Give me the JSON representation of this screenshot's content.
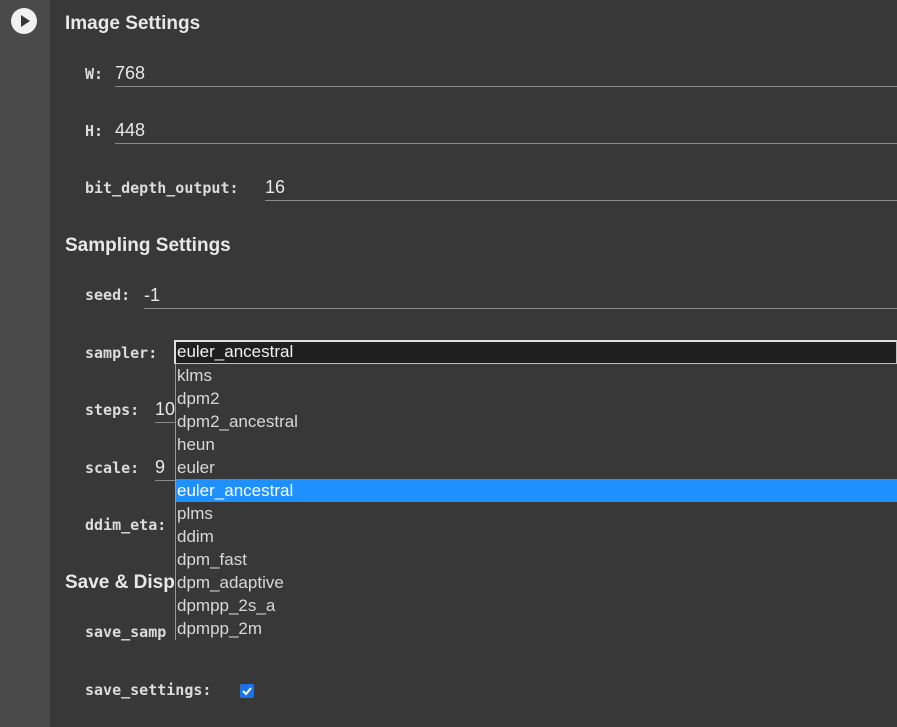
{
  "run_button": {
    "icon": "play-icon"
  },
  "image_settings": {
    "title": "Image Settings",
    "w": {
      "label": "W:",
      "value": "768"
    },
    "h": {
      "label": "H:",
      "value": "448"
    },
    "bit_depth_output": {
      "label": "bit_depth_output:",
      "value": "16"
    }
  },
  "sampling_settings": {
    "title": "Sampling Settings",
    "seed": {
      "label": "seed:",
      "value": "-1"
    },
    "sampler": {
      "label": "sampler:",
      "selected": "euler_ancestral",
      "options": [
        "klms",
        "dpm2",
        "dpm2_ancestral",
        "heun",
        "euler",
        "euler_ancestral",
        "plms",
        "ddim",
        "dpm_fast",
        "dpm_adaptive",
        "dpmpp_2s_a",
        "dpmpp_2m"
      ],
      "highlighted_index": 5
    },
    "steps": {
      "label": "steps:",
      "value": "10"
    },
    "scale": {
      "label": "scale:",
      "value": "9"
    },
    "ddim_eta": {
      "label": "ddim_eta:"
    }
  },
  "save_display": {
    "title": "Save & Displ",
    "save_samples": {
      "label": "save_samp"
    },
    "save_settings": {
      "label": "save_settings:",
      "checked": true
    }
  },
  "colors": {
    "accent": "#1e90ff",
    "checkbox": "#1a73e8",
    "background": "#383838",
    "gutter": "#4a4a4a"
  }
}
